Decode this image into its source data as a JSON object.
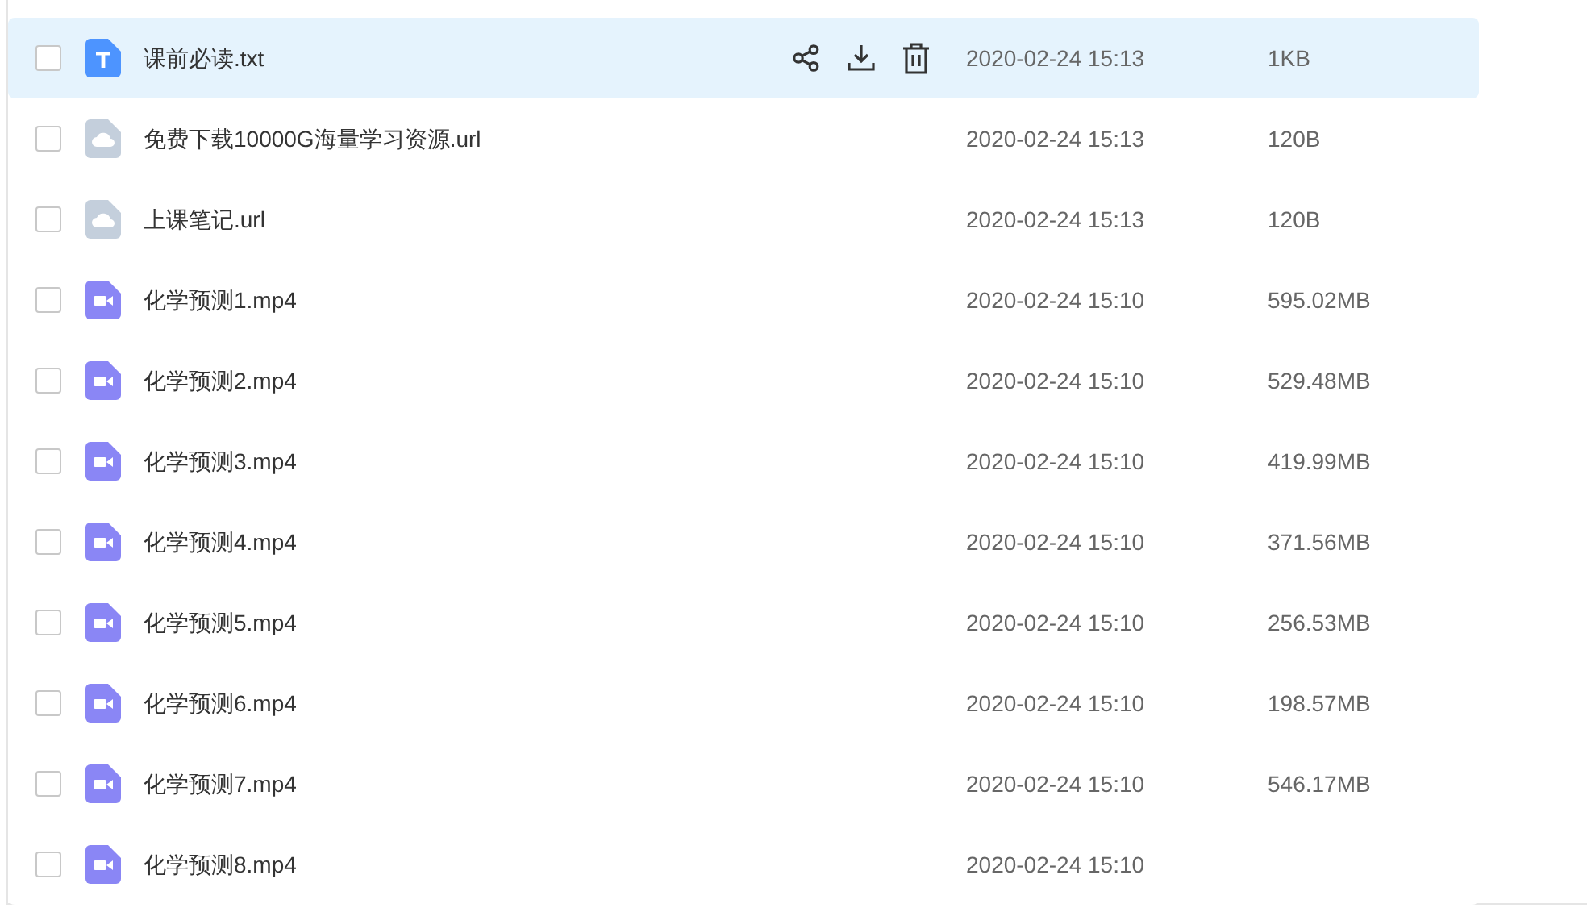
{
  "files": [
    {
      "kind": "text",
      "name": "课前必读.txt",
      "date": "2020-02-24 15:13",
      "size": "1KB",
      "checked": false,
      "highlighted": true
    },
    {
      "kind": "link",
      "name": "免费下载10000G海量学习资源.url",
      "date": "2020-02-24 15:13",
      "size": "120B",
      "checked": false,
      "highlighted": false
    },
    {
      "kind": "link",
      "name": "上课笔记.url",
      "date": "2020-02-24 15:13",
      "size": "120B",
      "checked": false,
      "highlighted": false
    },
    {
      "kind": "video",
      "name": "化学预测1.mp4",
      "date": "2020-02-24 15:10",
      "size": "595.02MB",
      "checked": false,
      "highlighted": false
    },
    {
      "kind": "video",
      "name": "化学预测2.mp4",
      "date": "2020-02-24 15:10",
      "size": "529.48MB",
      "checked": false,
      "highlighted": false
    },
    {
      "kind": "video",
      "name": "化学预测3.mp4",
      "date": "2020-02-24 15:10",
      "size": "419.99MB",
      "checked": false,
      "highlighted": false
    },
    {
      "kind": "video",
      "name": "化学预测4.mp4",
      "date": "2020-02-24 15:10",
      "size": "371.56MB",
      "checked": false,
      "highlighted": false
    },
    {
      "kind": "video",
      "name": "化学预测5.mp4",
      "date": "2020-02-24 15:10",
      "size": "256.53MB",
      "checked": false,
      "highlighted": false
    },
    {
      "kind": "video",
      "name": "化学预测6.mp4",
      "date": "2020-02-24 15:10",
      "size": "198.57MB",
      "checked": false,
      "highlighted": false
    },
    {
      "kind": "video",
      "name": "化学预测7.mp4",
      "date": "2020-02-24 15:10",
      "size": "546.17MB",
      "checked": false,
      "highlighted": false
    },
    {
      "kind": "video",
      "name": "化学预测8.mp4",
      "date": "2020-02-24 15:10",
      "checked": false,
      "highlighted": false
    }
  ]
}
